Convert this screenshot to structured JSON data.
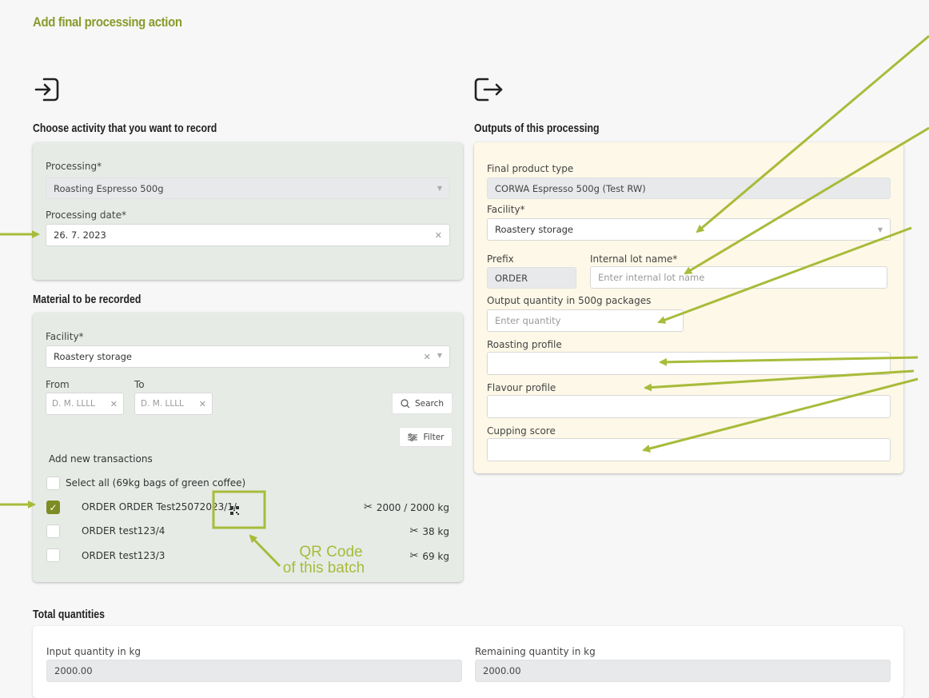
{
  "page": {
    "title": "Add final processing action"
  },
  "input_section": {
    "title": "Choose activity that you want to record",
    "icon": "log-in-icon",
    "processing_label": "Processing*",
    "processing_value": "Roasting Espresso 500g",
    "date_label": "Processing date*",
    "date_value": "26. 7. 2023"
  },
  "material_section": {
    "title": "Material to be recorded",
    "facility_label": "Facility*",
    "facility_value": "Roastery storage",
    "from_label": "From",
    "to_label": "To",
    "from_placeholder": "D. M. LLLL",
    "to_placeholder": "D. M. LLLL",
    "search_label": "Search",
    "filter_label": "Filter",
    "add_transactions_label": "Add new transactions",
    "select_all_label": "Select all (69kg bags of green coffee)",
    "rows": [
      {
        "name": "ORDER ORDER Test25072023/1/",
        "quantity": "2000 / 2000 kg",
        "checked": true,
        "qr": true
      },
      {
        "name": "ORDER test123/4",
        "quantity": "38 kg",
        "checked": false,
        "qr": false
      },
      {
        "name": "ORDER test123/3",
        "quantity": "69 kg",
        "checked": false,
        "qr": false
      }
    ]
  },
  "output_section": {
    "title": "Outputs of this processing",
    "icon": "log-out-icon",
    "final_product_label": "Final product type",
    "final_product_value": "CORWA Espresso 500g (Test RW)",
    "facility_label": "Facility*",
    "facility_value": "Roastery storage",
    "prefix_label": "Prefix",
    "prefix_value": "ORDER",
    "lot_label": "Internal lot name*",
    "lot_placeholder": "Enter internal lot name",
    "quantity_label": "Output quantity in 500g packages",
    "quantity_placeholder": "Enter quantity",
    "roasting_label": "Roasting profile",
    "flavour_label": "Flavour profile",
    "cupping_label": "Cupping score"
  },
  "totals": {
    "title": "Total quantities",
    "input_label": "Input quantity in kg",
    "input_value": "2000.00",
    "remaining_label": "Remaining quantity in kg",
    "remaining_value": "2000.00"
  },
  "annotation": {
    "line1": "QR Code",
    "line2": "of this batch"
  },
  "colors": {
    "accent": "#8a9a2b",
    "annotation": "#a8bb3a",
    "checkbox": "#7d8c24"
  }
}
